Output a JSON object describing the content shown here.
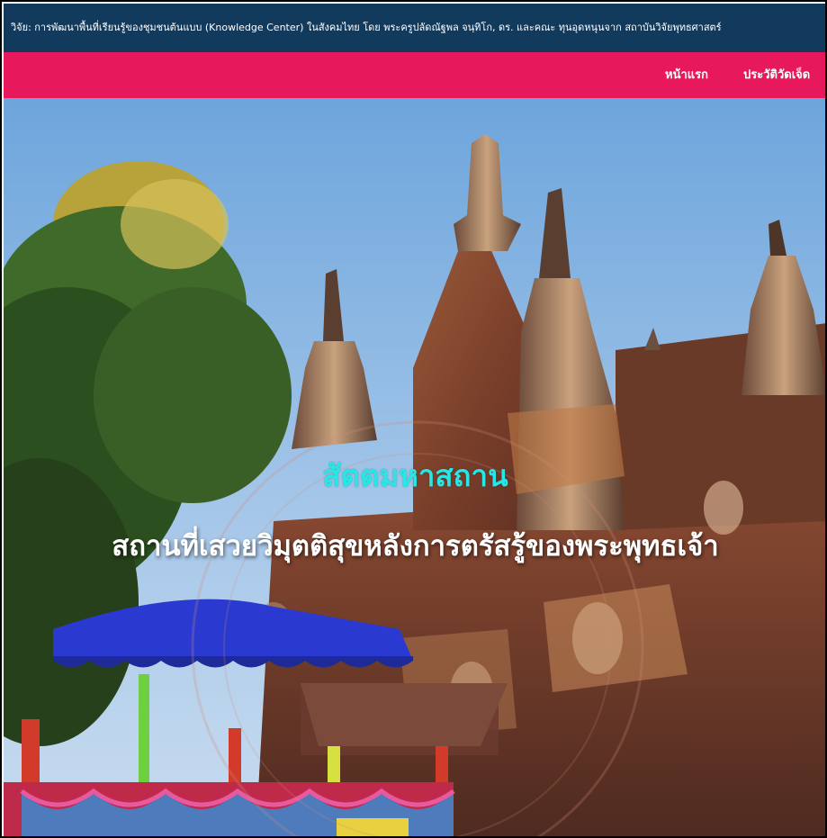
{
  "topbar": {
    "text": "วิจัย: การพัฒนาพื้นที่เรียนรู้ของชุมชนต้นแบบ (Knowledge Center) ในสังคมไทย โดย พระครูปลัดณัฐพล จนฺทิโก, ดร. และคณะ ทุนอุดหนุนจาก สถาบันวิจัยพุทธศาสตร์"
  },
  "nav": {
    "items": [
      {
        "label": "หน้าแรก"
      },
      {
        "label": "ประวัติวัดเจ็ด"
      }
    ]
  },
  "hero": {
    "title": "สัตตมหาสถาน",
    "subtitle": "สถานที่เสวยวิมุตติสุขหลังการตรัสรู้ของพระพุทธเจ้า"
  },
  "colors": {
    "topbar_bg": "#123a5c",
    "navbar_bg": "#e8185c",
    "title_color": "#27e6e6"
  }
}
